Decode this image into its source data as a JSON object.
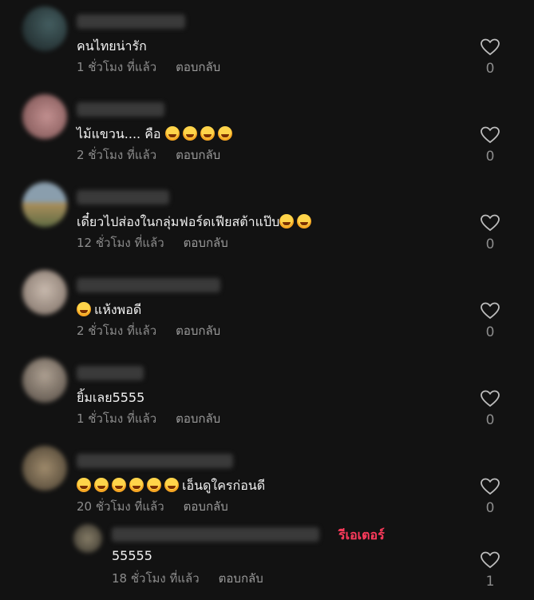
{
  "colors": {
    "background": "#121212",
    "creator_badge": "#ff3b5c",
    "muted": "#8c8c8c"
  },
  "comments": [
    {
      "text": "คนไทยน่ารัก",
      "time": "1 ชั่วโมง ที่แล้ว",
      "reply": "ตอบกลับ",
      "likes": "0",
      "emoji_count": 0,
      "emoji_prefix": 0
    },
    {
      "text": "ไม้แขวน.... คือ",
      "time": "2 ชั่วโมง ที่แล้ว",
      "reply": "ตอบกลับ",
      "likes": "0",
      "emoji_count": 4,
      "emoji_prefix": 0
    },
    {
      "text": "เดี๋ยวไปส่องในกลุ่มฟอร์ดเฟียสต้าแป๊บ",
      "time": "12 ชั่วโมง ที่แล้ว",
      "reply": "ตอบกลับ",
      "likes": "0",
      "emoji_count": 2,
      "emoji_prefix": 0
    },
    {
      "text": "แห้งพอดี",
      "time": "2 ชั่วโมง ที่แล้ว",
      "reply": "ตอบกลับ",
      "likes": "0",
      "emoji_count": 0,
      "emoji_prefix": 1
    },
    {
      "text": "ยิ้มเลย5555",
      "time": "1 ชั่วโมง ที่แล้ว",
      "reply": "ตอบกลับ",
      "likes": "0",
      "emoji_count": 0,
      "emoji_prefix": 0
    },
    {
      "text": "เอ็นดูใครก่อนดี",
      "time": "20 ชั่วโมง ที่แล้ว",
      "reply": "ตอบกลับ",
      "likes": "0",
      "emoji_count": 0,
      "emoji_prefix": 6
    }
  ],
  "reply_item": {
    "creator_label": "รีเอเตอร์",
    "text": "55555",
    "time": "18 ชั่วโมง ที่แล้ว",
    "reply": "ตอบกลับ",
    "likes": "1"
  },
  "icons": {
    "like": "heart-outline-icon",
    "emoji": "rolling-laughing-emoji-icon"
  }
}
